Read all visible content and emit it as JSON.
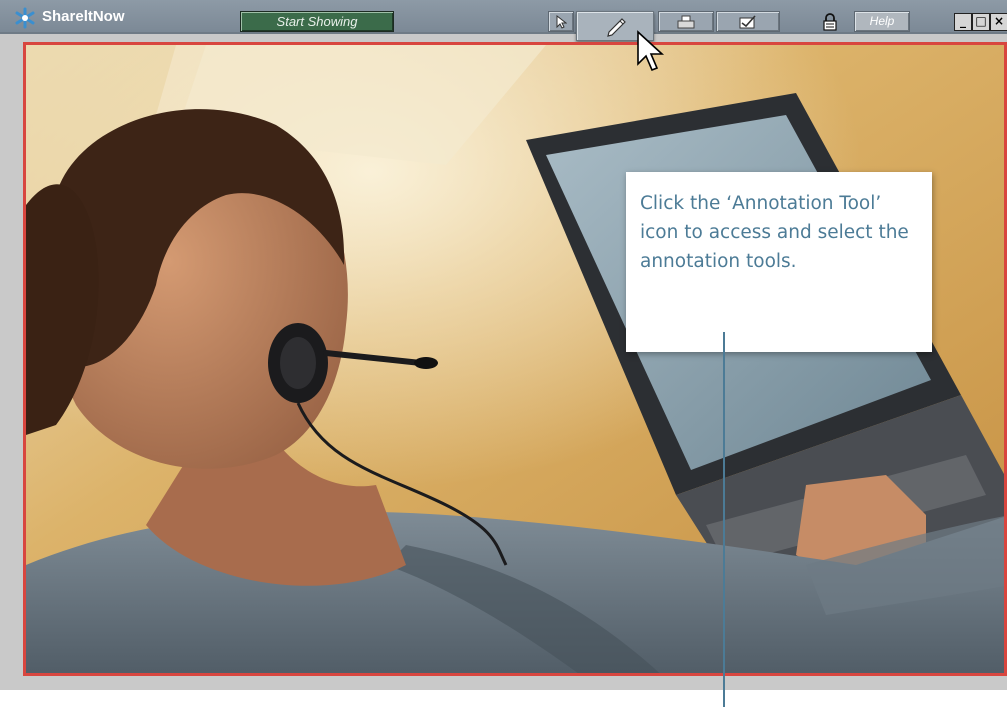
{
  "window": {
    "app_title": "ShareltNow",
    "start_button_label": "Start Showing",
    "help_button_label": "Help",
    "toolbar_icons": [
      "arrow-pointer-icon",
      "pen-annotation-icon",
      "printer-icon",
      "checkbox-icon",
      "lock-icon"
    ],
    "window_controls": {
      "minimize": "_",
      "restore": "□",
      "close": "×"
    }
  },
  "callout": {
    "text": "Click the ‘Annotation Tool’ icon to access and select the annotation tools."
  },
  "colors": {
    "titlebar": "#8493a0",
    "start_button": "#3b6b4a",
    "frame_border": "#d8463f",
    "callout_text": "#4c7b96"
  }
}
